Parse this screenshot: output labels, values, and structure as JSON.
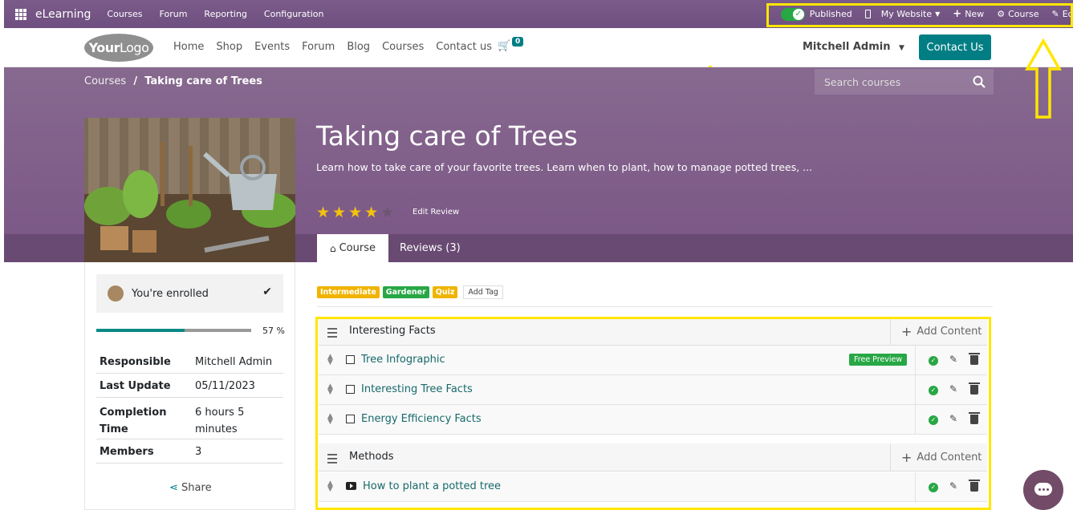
{
  "admin_bar": {
    "app_name": "eLearning",
    "menu": [
      "Courses",
      "Forum",
      "Reporting",
      "Configuration"
    ],
    "published_label": "Published",
    "website_label": "My Website",
    "new_label": "New",
    "course_label": "Course",
    "edit_label": "Edit"
  },
  "nav": {
    "logo_text_a": "Your",
    "logo_text_b": "Logo",
    "links": [
      "Home",
      "Shop",
      "Events",
      "Forum",
      "Blog",
      "Courses",
      "Contact us"
    ],
    "cart_count": "0",
    "user_name": "Mitchell Admin",
    "contact_button": "Contact Us"
  },
  "breadcrumb": {
    "root": "Courses",
    "separator": "/",
    "current": "Taking care of Trees"
  },
  "search": {
    "placeholder": "Search courses"
  },
  "course": {
    "title": "Taking care of Trees",
    "subtitle": "Learn how to take care of your favorite trees. Learn when to plant, how to manage potted trees, ...",
    "rating": 4,
    "rating_max": 5,
    "edit_review": "Edit Review",
    "tab_course": "Course",
    "tab_reviews": "Reviews (3)"
  },
  "sidebar": {
    "enrolled": "You're enrolled",
    "progress": 0.57,
    "progress_label": "57 %",
    "info": [
      {
        "key": "Responsible",
        "value": "Mitchell Admin"
      },
      {
        "key": "Last Update",
        "value": "05/11/2023"
      },
      {
        "key": "Completion Time",
        "value": "6 hours 5 minutes"
      },
      {
        "key": "Members",
        "value": "3"
      }
    ],
    "share": "Share"
  },
  "tags": [
    {
      "label": "Intermediate",
      "color": "#f0b400"
    },
    {
      "label": "Gardener",
      "color": "#28a745"
    },
    {
      "label": "Quiz",
      "color": "#f0b400"
    }
  ],
  "add_tag": "Add Tag",
  "add_content": "Add Content",
  "sections": [
    {
      "name": "Interesting Facts",
      "items": [
        {
          "name": "Tree Infographic",
          "type": "infographic",
          "badge": "Free Preview"
        },
        {
          "name": "Interesting Tree Facts",
          "type": "infographic"
        },
        {
          "name": "Energy Efficiency Facts",
          "type": "infographic"
        }
      ]
    },
    {
      "name": "Methods",
      "items": [
        {
          "name": "How to plant a potted tree",
          "type": "video"
        }
      ]
    }
  ],
  "colors": {
    "brand": "#714b67",
    "accent": "#017e84",
    "highlight": "#ffe600",
    "success": "#28a745"
  }
}
